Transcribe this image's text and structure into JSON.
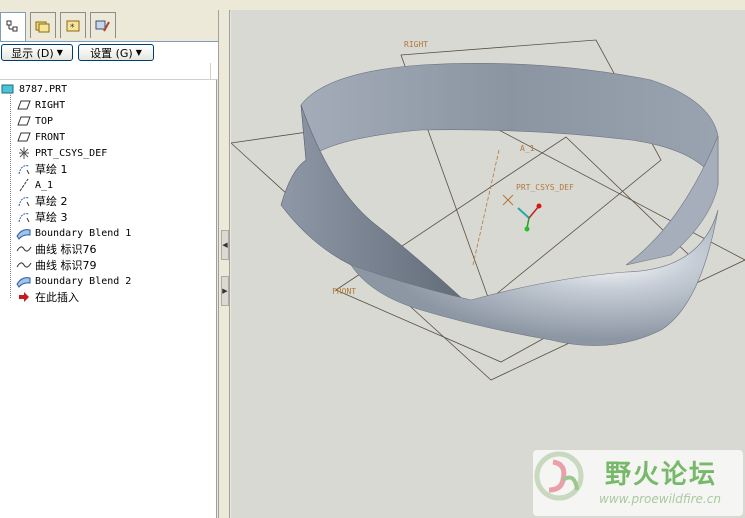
{
  "toolbar": {
    "display_label": "显示 (D)",
    "settings_label": "设置 (G)"
  },
  "tree": {
    "root": "8787.PRT",
    "items": [
      {
        "label": "RIGHT",
        "icon": "datum-plane-icon"
      },
      {
        "label": "TOP",
        "icon": "datum-plane-icon"
      },
      {
        "label": "FRONT",
        "icon": "datum-plane-icon"
      },
      {
        "label": "PRT_CSYS_DEF",
        "icon": "csys-icon"
      },
      {
        "label": "草绘 1",
        "icon": "sketch-icon"
      },
      {
        "label": "A_1",
        "icon": "datum-axis-icon"
      },
      {
        "label": "草绘 2",
        "icon": "sketch-icon"
      },
      {
        "label": "草绘 3",
        "icon": "sketch-icon"
      },
      {
        "label": "Boundary Blend 1",
        "icon": "boundary-blend-icon"
      },
      {
        "label": "曲线 标识76",
        "icon": "curve-icon"
      },
      {
        "label": "曲线 标识79",
        "icon": "curve-icon"
      },
      {
        "label": "Boundary Blend 2",
        "icon": "boundary-blend-icon"
      },
      {
        "label": "在此插入",
        "icon": "insert-here-arrow-icon"
      }
    ]
  },
  "viewport": {
    "datum_labels": {
      "right": "RIGHT",
      "front": "FRONT",
      "axis": "A_1",
      "csys": "PRT_CSYS_DEF"
    }
  },
  "watermark": {
    "title": "野火论坛",
    "url": "www.proewildfire.cn"
  },
  "colors": {
    "viewport_bg": "#d9d9d4",
    "surface": "#9ca6b2",
    "datum_line": "#5a5040",
    "datum_label": "#b07a3c",
    "watermark_green": "#77b96a"
  }
}
